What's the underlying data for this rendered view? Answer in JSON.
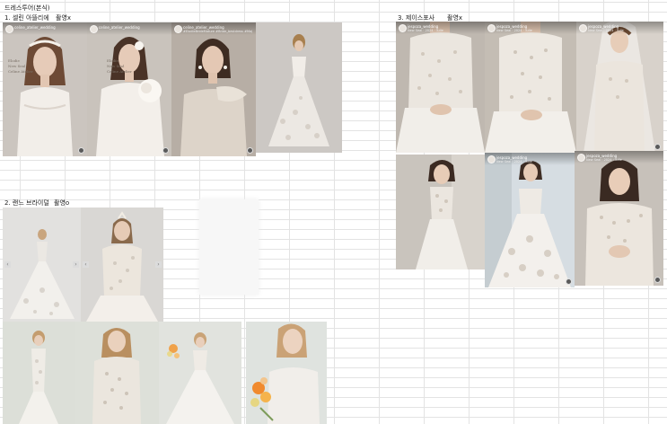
{
  "sheet": {
    "title": "드레스투어(본식)",
    "sections": [
      {
        "label": "1. 셀린 아뜰리에",
        "status": "촬영x"
      },
      {
        "label": "2. 랜느 브라이덜",
        "status": "촬영o"
      },
      {
        "label": "3. 제이스포사",
        "status": "촬영x"
      }
    ]
  },
  "celine_cards": [
    {
      "account": "celine_atelier_wedding",
      "caption": "",
      "overlay": "Elodie\nNew Seal\nCeline Atelier"
    },
    {
      "account": "celine_atelier_wedding",
      "caption": "",
      "overlay": "Elodie\nNew Seal\nCeline Atelier"
    },
    {
      "account": "celine_atelier_wedding",
      "caption": "#ElodieBrideMature #Bride_bestdress #Maj",
      "overlay": ""
    },
    {
      "account": "",
      "caption": "",
      "overlay": ""
    }
  ],
  "jespoza_cards": [
    {
      "account": "jespoza_wedding",
      "caption": "New Seal · 2024 · Tulle"
    },
    {
      "account": "jespoza_wedding",
      "caption": "New Seal · 2024 · Tulle"
    },
    {
      "account": "jespoza_wedding",
      "caption": "New Seal · 2024 · Tulle"
    },
    {
      "account": "",
      "caption": ""
    },
    {
      "account": "jespoza_wedding",
      "caption": "New Seal · 2024 · Tulle"
    },
    {
      "account": "jespoza_wedding",
      "caption": "New Seal · 2024 · Tulle"
    }
  ],
  "icons": {
    "prev": "chevron-left-icon",
    "next": "chevron-right-icon",
    "media": "carousel-dot-icon"
  }
}
